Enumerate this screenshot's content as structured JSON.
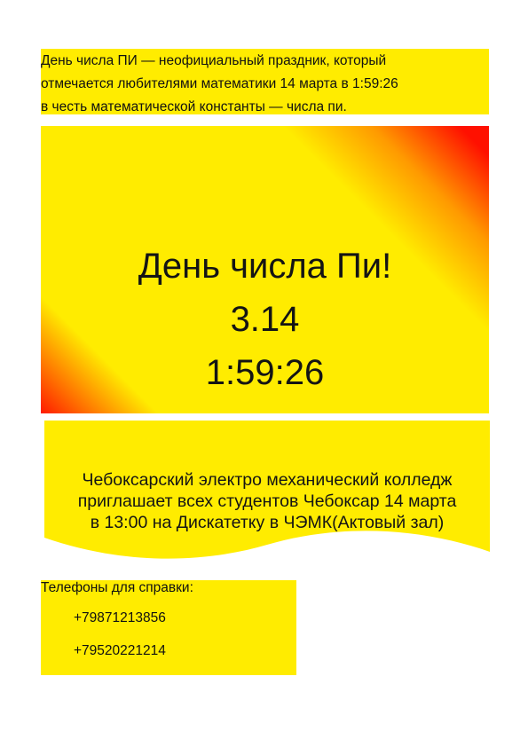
{
  "intro": {
    "lines": [
      "День числа ПИ — неофициальный праздник, который",
      "отмечается любителями математики 14 марта в 1:59:26",
      "в честь математической константы — числа пи."
    ]
  },
  "banner": {
    "title": "День числа Пи!",
    "number": "3.14",
    "time": "1:59:26",
    "colors": {
      "yellow": "#ffec00",
      "red": "#ff1a00"
    }
  },
  "invitation": {
    "lines": [
      "Чебоксарский электро механический колледж",
      "приглашает всех студентов Чебоксар 14 марта",
      "в 13:00 на Дискатетку в ЧЭМК(Актовый зал)"
    ]
  },
  "contacts": {
    "heading": "Телефоны для справки:",
    "phones": [
      "+79871213856",
      "+79520221214"
    ]
  }
}
